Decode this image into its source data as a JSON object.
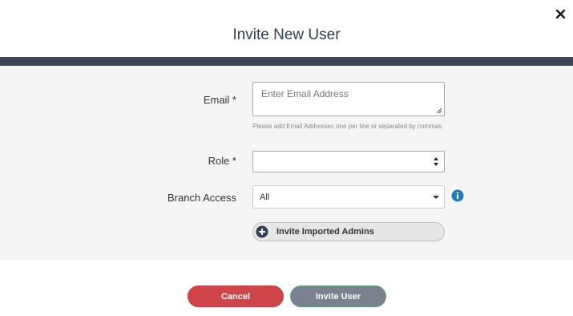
{
  "dialog": {
    "title": "Invite New User",
    "close_icon": "close-icon"
  },
  "form": {
    "email": {
      "label": "Email *",
      "value": "",
      "placeholder": "Enter Email Address",
      "hint": "Please add Email Addresses one per line or separated by commas."
    },
    "role": {
      "label": "Role *",
      "value": ""
    },
    "branch_access": {
      "label": "Branch Access",
      "value": "All",
      "info_icon": "info-icon"
    },
    "import_button": {
      "label": "Invite Imported Admins",
      "icon": "plus-circle-icon"
    }
  },
  "footer": {
    "cancel_label": "Cancel",
    "invite_label": "Invite User"
  },
  "colors": {
    "header_band": "#3b4658",
    "cancel": "#d0454a",
    "invite": "#7a8290",
    "info": "#1a7fc1"
  }
}
